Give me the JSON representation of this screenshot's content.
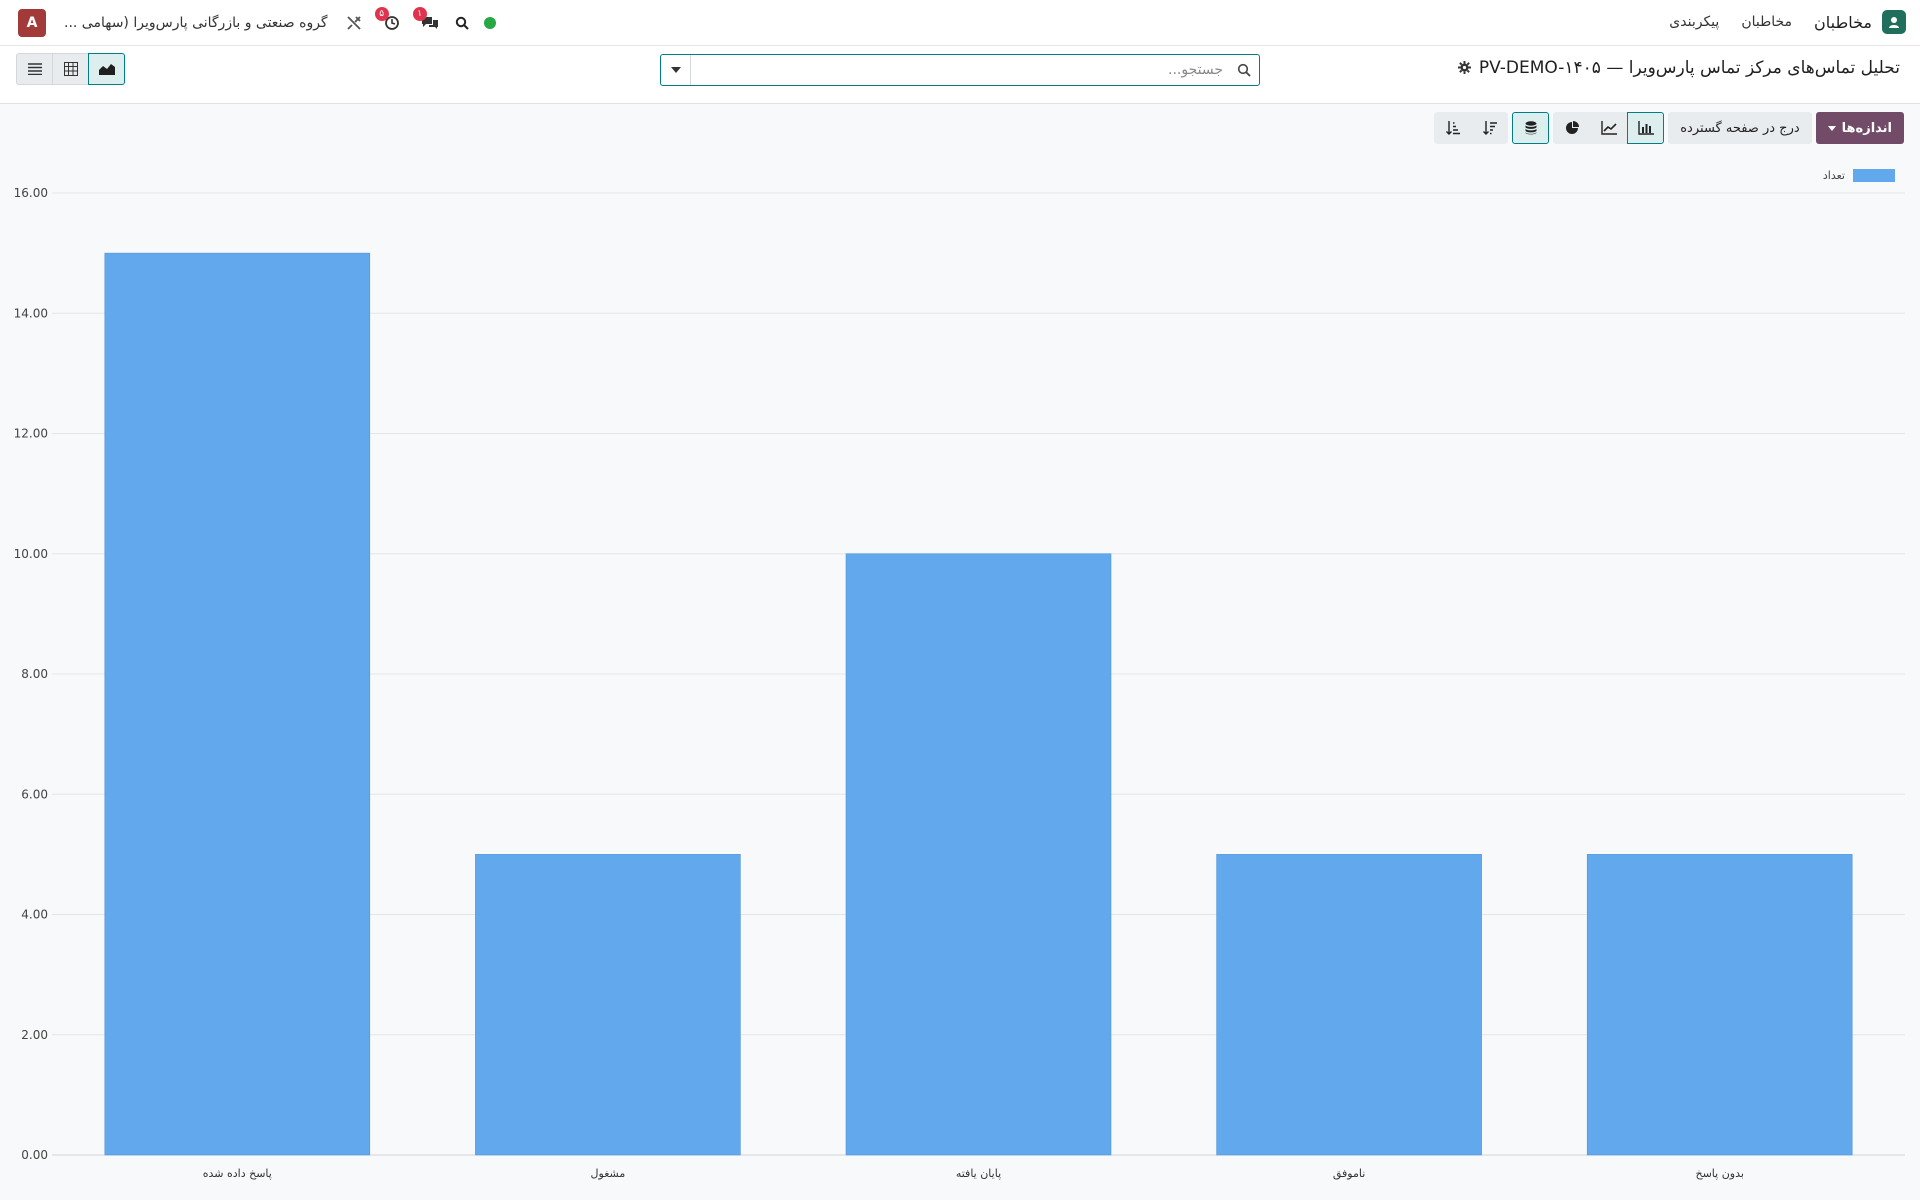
{
  "navbar": {
    "avatar_letter": "A",
    "company_name": "گروه صنعتی و بازرگانی پارس‌ویرا (سهامی ...",
    "activity_badge": "۵",
    "messages_badge": "۱",
    "app_name": "مخاطبان",
    "menu": [
      "مخاطبان",
      "پیکربندی"
    ]
  },
  "control_panel": {
    "page_title": "تحلیل تماس‌های مرکز تماس پارس‌ویرا — PV-DEMO-۱۴۰۵",
    "search_placeholder": "جستجو...",
    "views": [
      "list-view",
      "pivot-view",
      "graph-view"
    ],
    "active_view": "graph-view"
  },
  "toolbar": {
    "measures_label": "اندازه‌ها",
    "insert_label": "درج در صفحه گسترده",
    "chart_types": [
      "bar",
      "line",
      "pie"
    ],
    "active_chart_type": "bar",
    "stacked_active": true
  },
  "chart_data": {
    "type": "bar",
    "categories": [
      "پاسخ داده شده",
      "مشغول",
      "پایان یافته",
      "ناموفق",
      "بدون پاسخ"
    ],
    "series": [
      {
        "name": "تعداد",
        "values": [
          15,
          5,
          10,
          5,
          5
        ],
        "color": "#62a8ec"
      }
    ],
    "ylim": [
      0,
      16
    ],
    "yticks": [
      "0.00",
      "2.00",
      "4.00",
      "6.00",
      "8.00",
      "10.00",
      "12.00",
      "14.00",
      "16.00"
    ],
    "legend_position": "top-right",
    "grid": true
  }
}
